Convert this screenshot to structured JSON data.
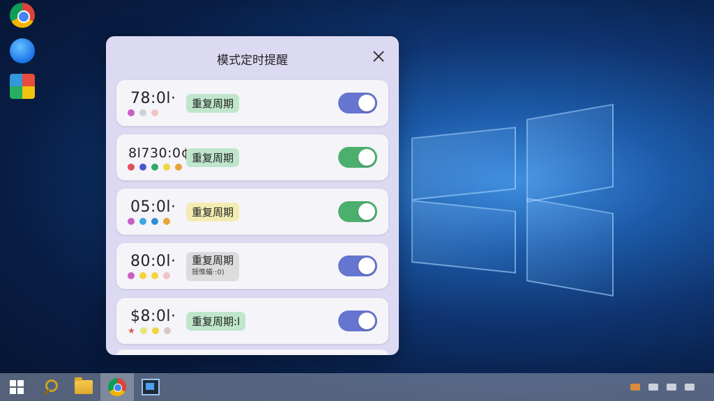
{
  "desktop": {
    "icons": [
      {
        "label": "",
        "icon": "chrome-icon"
      },
      {
        "label": "",
        "icon": "edge-icon"
      },
      {
        "label": "",
        "icon": "app-tiles-icon"
      }
    ]
  },
  "dialog": {
    "title": "模式定时提醒",
    "close_icon": "close-icon",
    "alarms": [
      {
        "time": "78:0l·",
        "badge": "重复周期",
        "badge_sub": "",
        "badge_color": "#bfe6cc",
        "enabled": true,
        "toggle_color": "#6675cf",
        "dots": [
          "#c85fc2",
          "#cfcfd8",
          "#f2c3c3"
        ]
      },
      {
        "time": "8l730:0¢",
        "badge": "重复周期",
        "badge_sub": "",
        "badge_color": "#bfe6cc",
        "enabled": true,
        "toggle_color": "#4caf6e",
        "dots": [
          "#e34c5b",
          "#4b55d6",
          "#2fa86c",
          "#f2d43c",
          "#e8a43a"
        ]
      },
      {
        "time": "05:0l·",
        "badge": "重复周期",
        "badge_sub": "",
        "badge_color": "#f2ecb3",
        "enabled": true,
        "toggle_color": "#4caf6e",
        "dots": [
          "#c85fc2",
          "#3aa7e0",
          "#2f8fd0",
          "#e8a43a"
        ]
      },
      {
        "time": "80:0l·",
        "badge": "重复周期",
        "badge_sub": "揺惟蟻·:0)",
        "badge_color": "#dcdcdc",
        "enabled": true,
        "toggle_color": "#6675cf",
        "dots": [
          "#c85fc2",
          "#f2d43c",
          "#f2d43c",
          "#f2c3c3"
        ]
      },
      {
        "time": "$8:0l·",
        "badge": "重复周期:l",
        "badge_sub": "",
        "badge_color": "#bfe6cc",
        "enabled": true,
        "toggle_color": "#6675cf",
        "dots": [
          "#e8e57a",
          "#f2d43c",
          "#d8c6c6"
        ]
      }
    ]
  },
  "taskbar": {
    "items": [
      "start-icon",
      "search-icon",
      "file-explorer-icon",
      "chrome-icon",
      "terminal-icon"
    ],
    "active_item": "chrome-icon"
  }
}
